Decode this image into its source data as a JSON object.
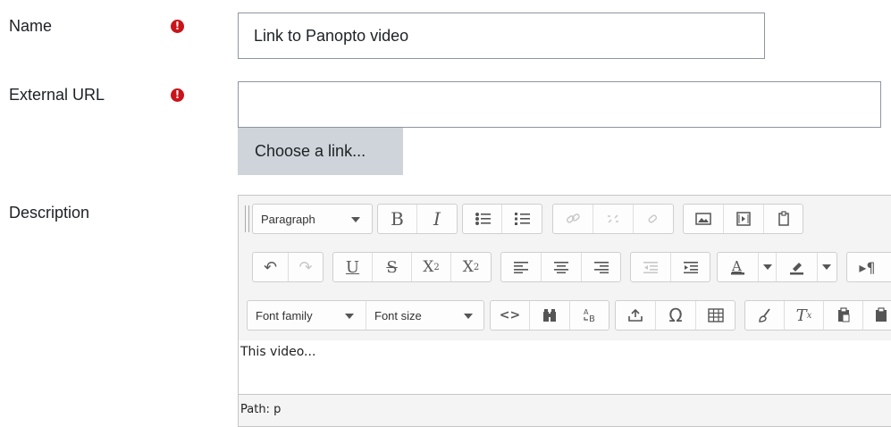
{
  "form": {
    "name_label": "Name",
    "name_value": "Link to Panopto video",
    "url_label": "External URL",
    "url_value": "",
    "choose_link_label": "Choose a link...",
    "description_label": "Description",
    "required_mark": "!"
  },
  "editor": {
    "block_format": "Paragraph",
    "bold": "B",
    "italic": "I",
    "underline": "U",
    "strike": "S",
    "subscript": "X",
    "sub_mark": "2",
    "superscript": "X",
    "sup_mark": "2",
    "font_family": "Font family",
    "font_size": "Font size",
    "code": "<>",
    "omega": "Ω",
    "clear_format": "T",
    "clear_mark": "x",
    "content": "This video...",
    "path": "Path: p"
  }
}
